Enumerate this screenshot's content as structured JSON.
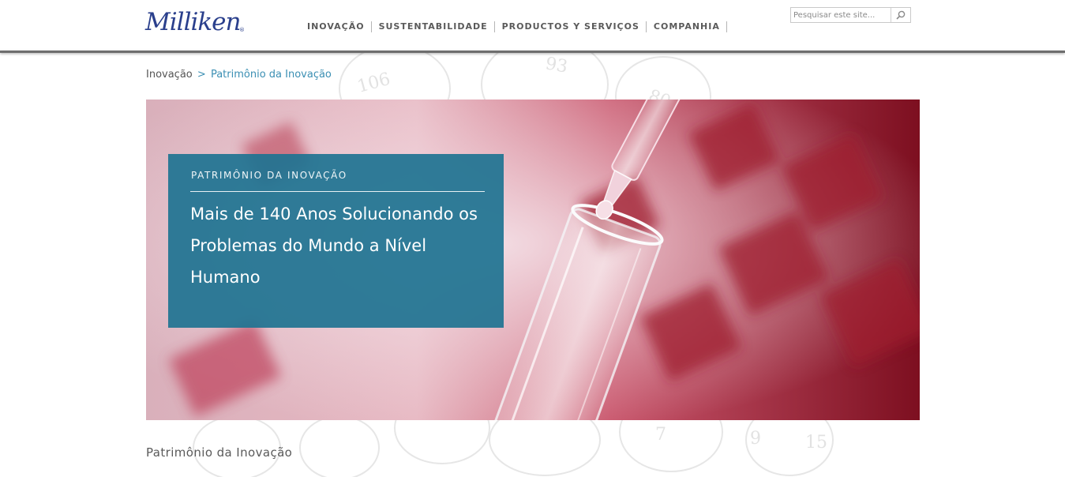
{
  "header": {
    "logo_text": "Milliken",
    "logo_mark": "®",
    "nav": [
      {
        "label": "INOVAÇÃO"
      },
      {
        "label": "SUSTENTABILIDADE"
      },
      {
        "label": "PRODUCTOS Y SERVIÇOS"
      },
      {
        "label": "COMPANHIA"
      }
    ],
    "search": {
      "placeholder": "Pesquisar este site...",
      "icon": "search-icon"
    }
  },
  "breadcrumb": {
    "parent": "Inovação",
    "separator": ">",
    "current": "Patrimônio da Inovação"
  },
  "hero": {
    "eyebrow": "PATRIMÔNIO DA INOVAÇÃO",
    "title": "Mais de 140 Anos Solucionando os Problemas do Mundo a Nível Humano",
    "card_color": "#1e7391"
  },
  "section": {
    "title": "Patrimônio da Inovação"
  },
  "colors": {
    "brand": "#2a3f8c",
    "link": "#3b8fb3",
    "nav_text": "#5a5a5a"
  }
}
